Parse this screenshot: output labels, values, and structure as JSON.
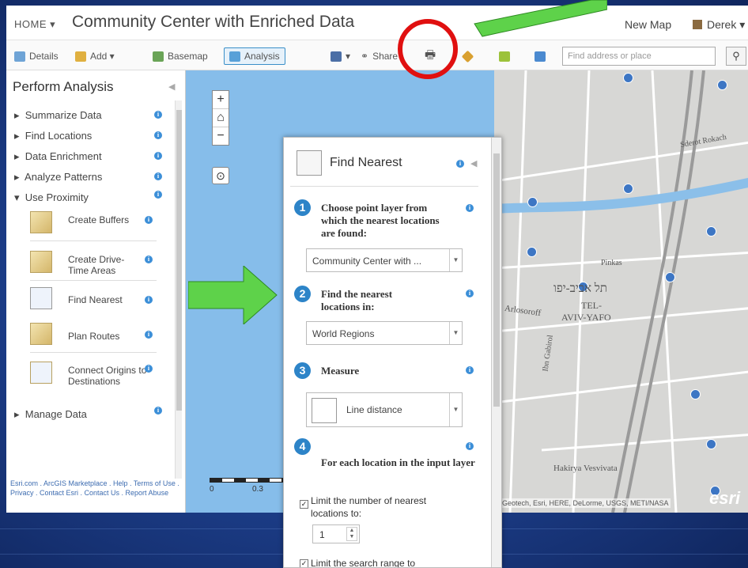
{
  "header": {
    "home": "HOME ▾",
    "title": "Community Center with Enriched Data",
    "new_map": "New Map",
    "user": "Derek ▾"
  },
  "toolbar": {
    "details": "Details",
    "add": "Add ▾",
    "basemap": "Basemap",
    "analysis": "Analysis",
    "save": "▾",
    "share": "Share",
    "search_placeholder": "Find address or place"
  },
  "panel": {
    "title": "Perform Analysis",
    "categories": [
      "Summarize Data",
      "Find Locations",
      "Data Enrichment",
      "Analyze Patterns",
      "Use Proximity",
      "Manage Data"
    ],
    "tools": [
      "Create Buffers",
      "Create Drive-Time Areas",
      "Find Nearest",
      "Plan Routes",
      "Connect Origins to Destinations"
    ],
    "footer": "Esri.com . ArcGIS Marketplace . Help . Terms of Use . Privacy . Contact Esri . Contact Us . Report Abuse"
  },
  "map": {
    "zoom_in": "+",
    "home": "⌂",
    "zoom_out": "−",
    "scale_0": "0",
    "scale_1": "0.3",
    "label_tlv": "תל אביב-יפו",
    "label_tel": "TEL-",
    "label_aviv": "AVIV-YAFO",
    "label_arlos": "Arlosoroff",
    "label_pinkas": "Pinkas",
    "label_sderot": "Sderot Rokach",
    "label_ibn": "Ibn Gabirol",
    "label_hakirya": "Hakirya Vesvivata",
    "attribution": "Geotech, Esri, HERE, DeLorme, USGS, METI/NASA",
    "esri": "esri"
  },
  "find_nearest": {
    "title": "Find Nearest",
    "step1": "Choose point layer from which the nearest locations are found:",
    "layer_value": "Community Center with ...",
    "step2": "Find the nearest locations in:",
    "near_value": "World Regions",
    "step3": "Measure",
    "measure_value": "Line distance",
    "step4": "For each location in the input layer",
    "limit_nearest": "Limit the number of nearest locations to:",
    "limit_value": "1",
    "limit_range": "Limit the search range to"
  },
  "colors": {
    "accent": "#2d84c8",
    "arrow": "#5ed24a",
    "highlight": "#e01010"
  }
}
